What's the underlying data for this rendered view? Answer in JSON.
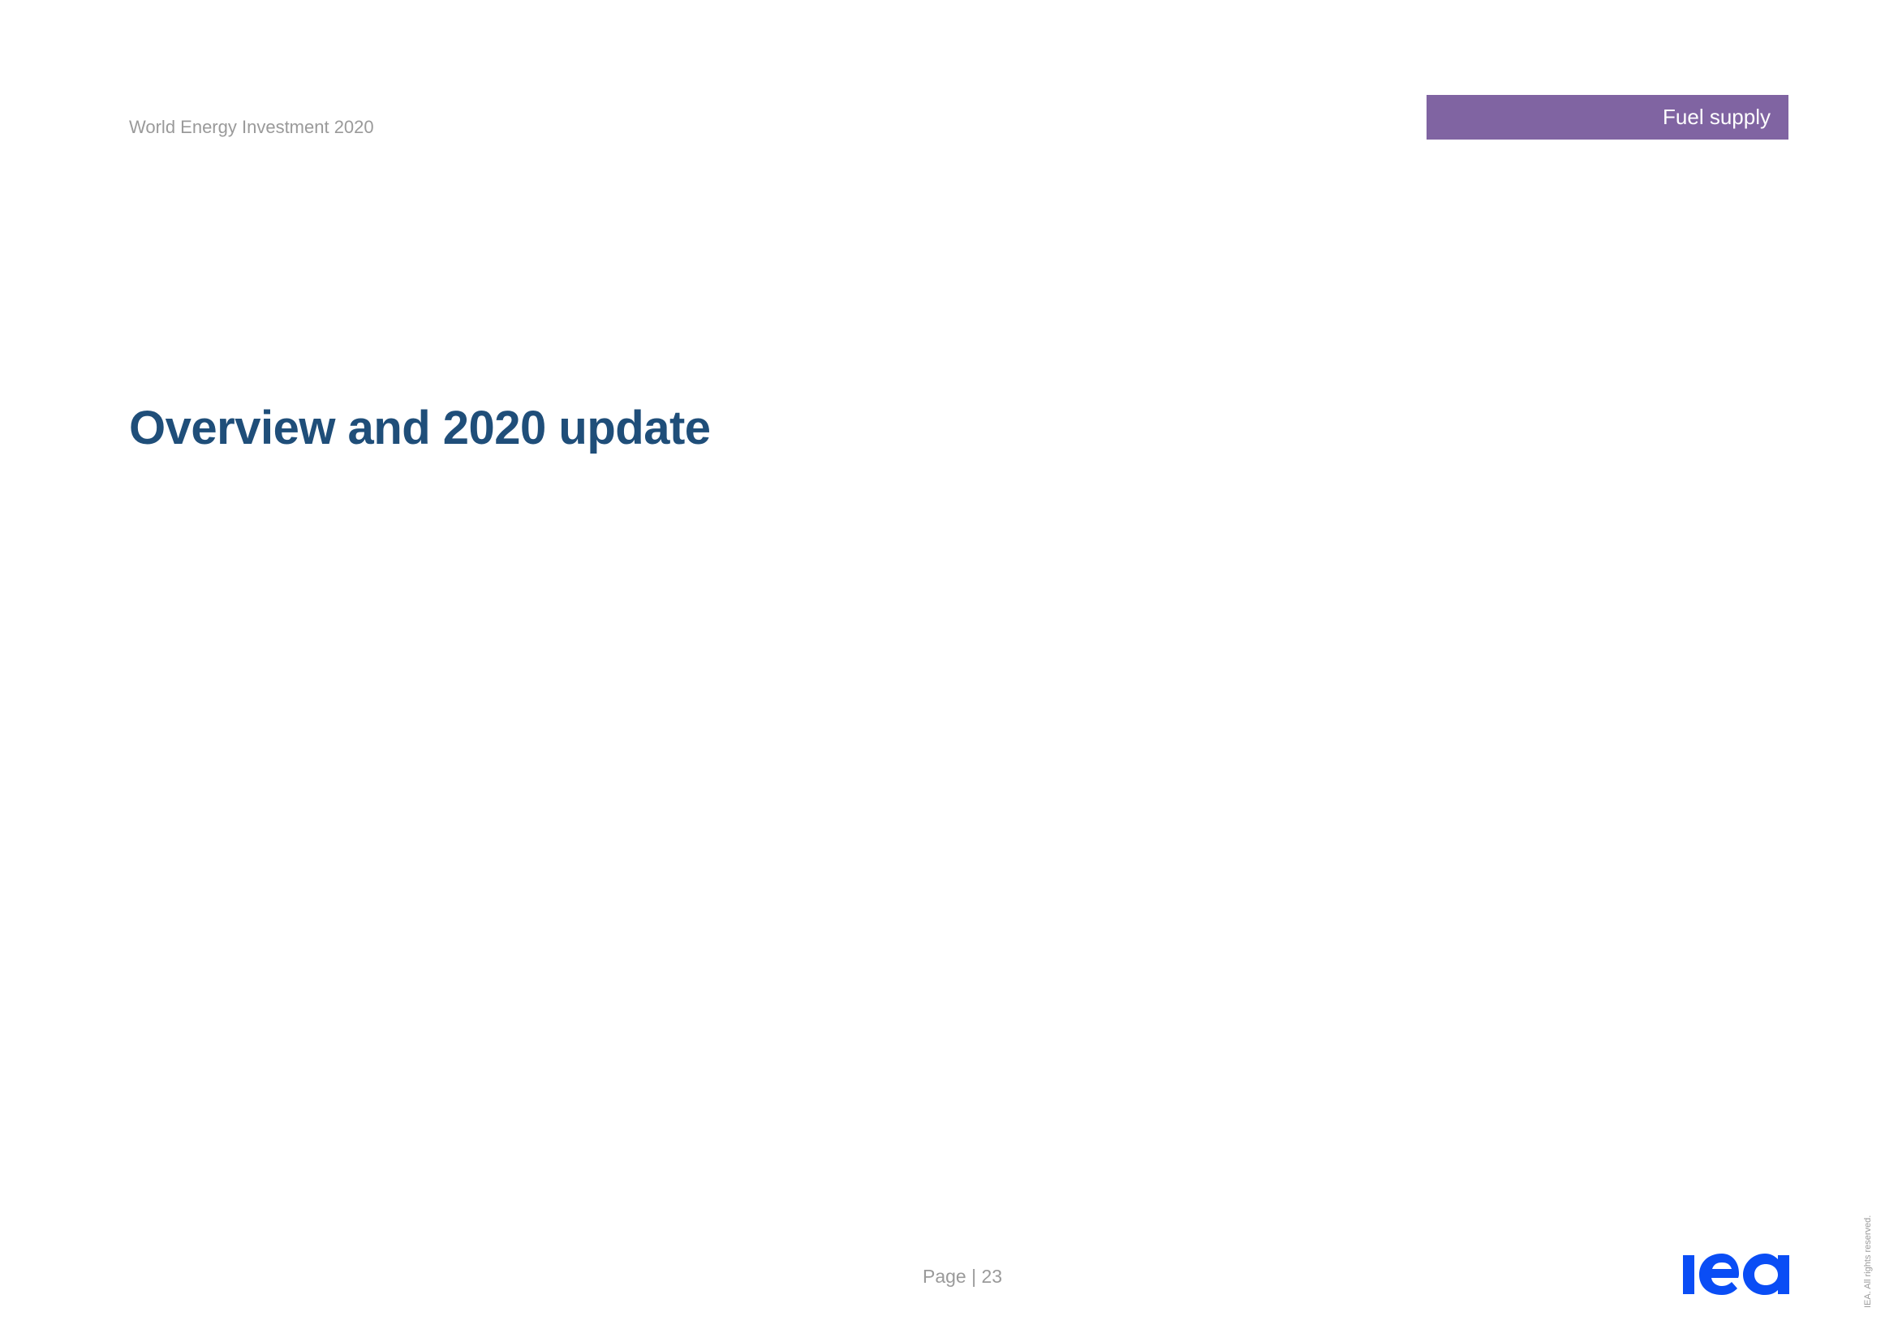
{
  "header": {
    "report_title": "World Energy Investment 2020",
    "section_label": "Fuel supply",
    "section_color": "#8064a2"
  },
  "main": {
    "heading": "Overview and 2020 update",
    "heading_color": "#1f4e79"
  },
  "footer": {
    "page_label": "Page | 23",
    "logo": {
      "icon": "iea-logo-icon",
      "text": "iea",
      "color": "#0a4df5"
    },
    "rights": "IEA. All rights reserved."
  }
}
